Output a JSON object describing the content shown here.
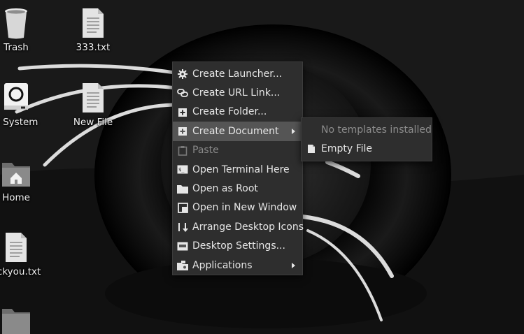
{
  "desktop": {
    "icons": [
      {
        "label": "Trash",
        "icon": "trash-icon"
      },
      {
        "label": "333.txt",
        "icon": "text-file-icon"
      },
      {
        "label": "e System",
        "icon": "file-system-icon"
      },
      {
        "label": "New File",
        "icon": "text-file-icon"
      },
      {
        "label": "Home",
        "icon": "home-folder-icon"
      },
      {
        "label": "ockyou.txt",
        "icon": "text-file-icon"
      },
      {
        "label": "",
        "icon": "folder-icon"
      }
    ]
  },
  "context_menu": {
    "items": [
      {
        "label": "Create Launcher...",
        "icon": "gear-icon",
        "state": "normal"
      },
      {
        "label": "Create URL Link...",
        "icon": "link-icon",
        "state": "normal"
      },
      {
        "label": "Create Folder...",
        "icon": "new-folder-icon",
        "state": "normal"
      },
      {
        "label": "Create Document",
        "icon": "new-document-icon",
        "state": "active",
        "submenu": true
      },
      {
        "label": "Paste",
        "icon": "clipboard-icon",
        "state": "disabled"
      },
      {
        "label": "Open Terminal Here",
        "icon": "terminal-icon",
        "state": "normal"
      },
      {
        "label": "Open as Root",
        "icon": "folder-icon",
        "state": "normal"
      },
      {
        "label": "Open in New Window",
        "icon": "new-window-icon",
        "state": "normal"
      },
      {
        "label": "Arrange Desktop Icons",
        "icon": "sort-down-icon",
        "state": "normal"
      },
      {
        "label": "Desktop Settings...",
        "icon": "desktop-settings-icon",
        "state": "normal"
      },
      {
        "label": "Applications",
        "icon": "applications-icon",
        "state": "normal",
        "submenu": true
      }
    ]
  },
  "document_submenu": {
    "info": "No templates installed",
    "items": [
      {
        "label": "Empty File",
        "icon": "document-icon"
      }
    ]
  },
  "colors": {
    "menu_bg": "#2e2e2e",
    "menu_active": "#555555",
    "menu_text": "#e6e6e6",
    "menu_disabled": "#8a8a8a"
  }
}
